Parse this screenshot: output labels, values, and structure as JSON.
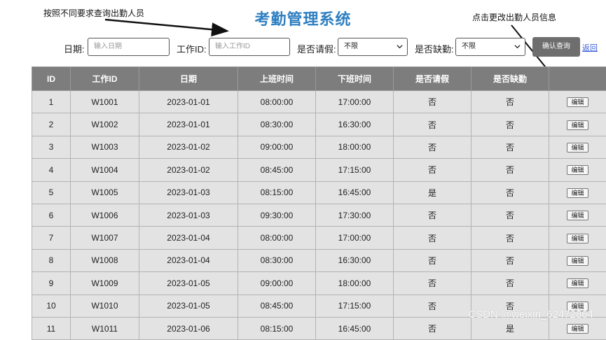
{
  "page": {
    "title": "考勤管理系统"
  },
  "annotations": {
    "left": "按照不同要求查询出勤人员",
    "right": "点击更改出勤人员信息"
  },
  "filters": {
    "date_label": "日期:",
    "date_placeholder": "输入日期",
    "work_id_label": "工作ID:",
    "work_id_placeholder": "输入工作ID",
    "leave_label": "是否请假:",
    "leave_value": "不限",
    "absent_label": "是否缺勤:",
    "absent_value": "不限",
    "query_button": "确认查询",
    "back_link": "返回"
  },
  "table": {
    "headers": [
      "ID",
      "工作ID",
      "日期",
      "上班时间",
      "下班时间",
      "是否请假",
      "是否缺勤",
      ""
    ],
    "edit_label": "编辑",
    "rows": [
      [
        "1",
        "W1001",
        "2023-01-01",
        "08:00:00",
        "17:00:00",
        "否",
        "否"
      ],
      [
        "2",
        "W1002",
        "2023-01-01",
        "08:30:00",
        "16:30:00",
        "否",
        "否"
      ],
      [
        "3",
        "W1003",
        "2023-01-02",
        "09:00:00",
        "18:00:00",
        "否",
        "否"
      ],
      [
        "4",
        "W1004",
        "2023-01-02",
        "08:45:00",
        "17:15:00",
        "否",
        "否"
      ],
      [
        "5",
        "W1005",
        "2023-01-03",
        "08:15:00",
        "16:45:00",
        "是",
        "否"
      ],
      [
        "6",
        "W1006",
        "2023-01-03",
        "09:30:00",
        "17:30:00",
        "否",
        "否"
      ],
      [
        "7",
        "W1007",
        "2023-01-04",
        "08:00:00",
        "17:00:00",
        "否",
        "否"
      ],
      [
        "8",
        "W1008",
        "2023-01-04",
        "08:30:00",
        "16:30:00",
        "否",
        "否"
      ],
      [
        "9",
        "W1009",
        "2023-01-05",
        "09:00:00",
        "18:00:00",
        "否",
        "否"
      ],
      [
        "10",
        "W1010",
        "2023-01-05",
        "08:45:00",
        "17:15:00",
        "否",
        "否"
      ],
      [
        "11",
        "W1011",
        "2023-01-06",
        "08:15:00",
        "16:45:00",
        "否",
        "是"
      ]
    ]
  },
  "watermark": "CSDN @weixin_62472864"
}
